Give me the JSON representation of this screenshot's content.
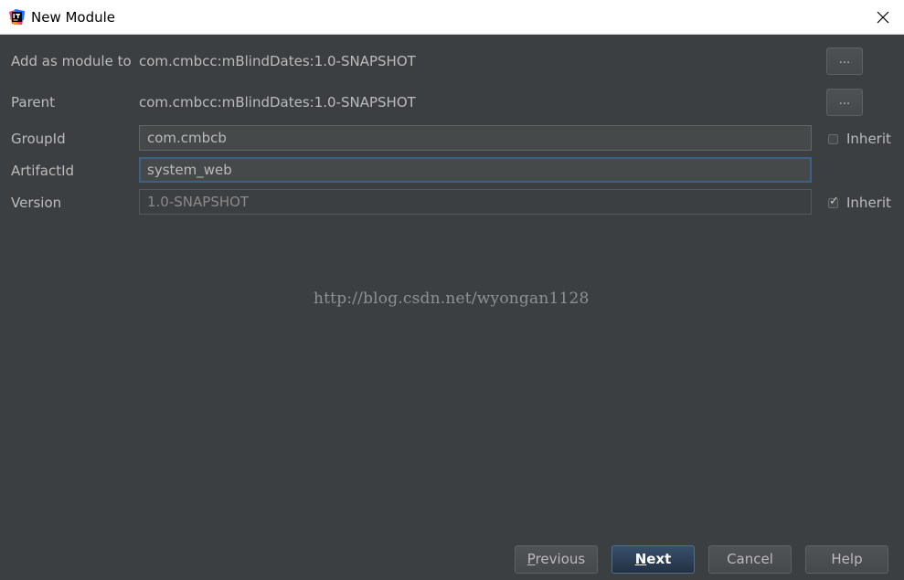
{
  "window": {
    "title": "New Module",
    "icon": "intellij-idea-icon",
    "close_icon": "close-icon"
  },
  "form": {
    "add_as_module_to": {
      "label": "Add as module to",
      "value": "com.cmbcc:mBlindDates:1.0-SNAPSHOT",
      "browse_label": "..."
    },
    "parent": {
      "label": "Parent",
      "value": "com.cmbcc:mBlindDates:1.0-SNAPSHOT",
      "browse_label": "..."
    },
    "group_id": {
      "label": "GroupId",
      "value": "com.cmbcb",
      "inherit_label": "Inherit",
      "inherit_checked": false
    },
    "artifact_id": {
      "label": "ArtifactId",
      "value": "system_web"
    },
    "version": {
      "label": "Version",
      "value": "1.0-SNAPSHOT",
      "inherit_label": "Inherit",
      "inherit_checked": true
    }
  },
  "watermark": "http://blog.csdn.net/wyongan1128",
  "footer": {
    "previous": {
      "mnemonic": "P",
      "rest": "revious"
    },
    "next": {
      "mnemonic": "N",
      "rest": "ext"
    },
    "cancel": "Cancel",
    "help": "Help"
  },
  "colors": {
    "background": "#3c3f41",
    "text": "#bbbbbb",
    "focus_border": "#3d6185",
    "default_button": "#2f4256"
  }
}
